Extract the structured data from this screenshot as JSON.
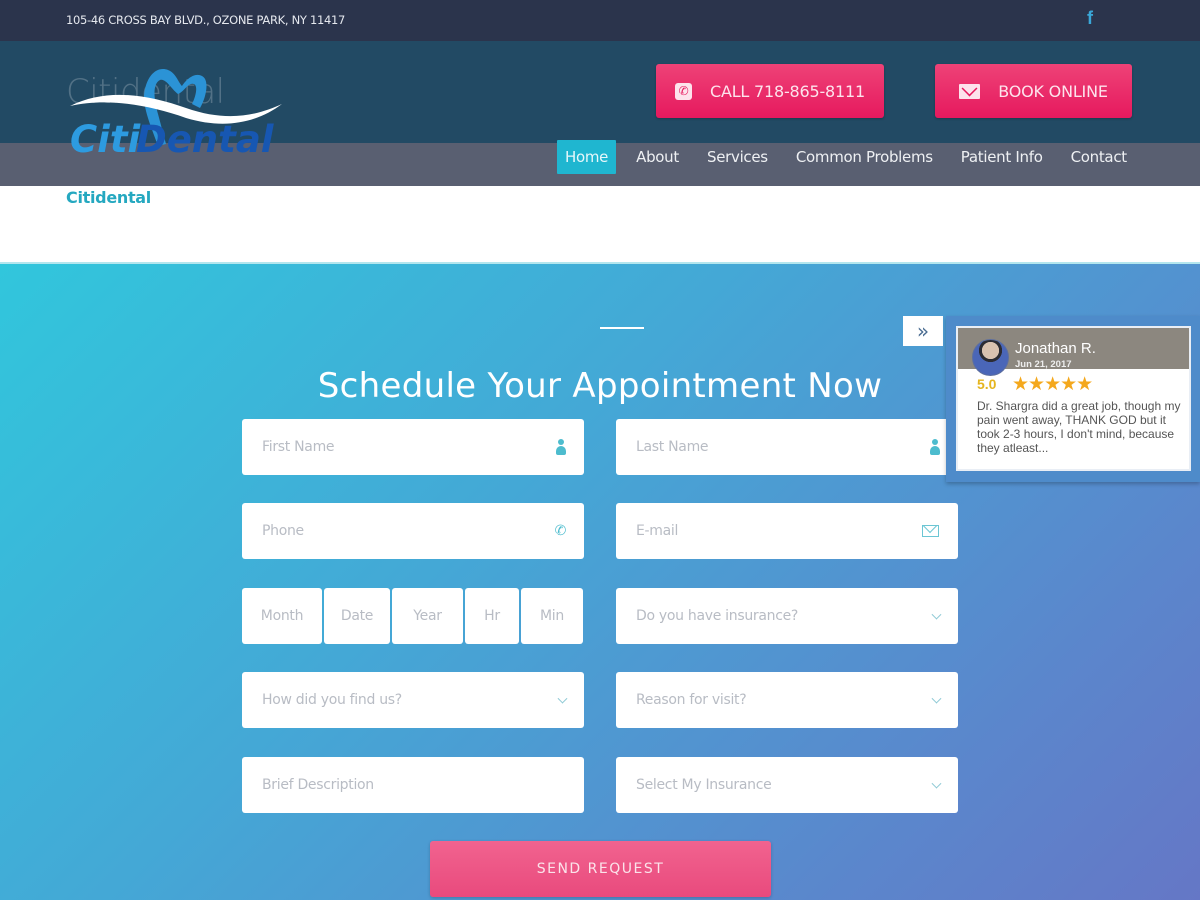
{
  "topbar": {
    "address": "105-46 CROSS BAY BLVD., OZONE PARK, NY 11417",
    "social_icon": "facebook-icon",
    "social_glyph": "f"
  },
  "header": {
    "logo_ghost_text": "Citidental",
    "logo_text_part1": "Citi",
    "logo_text_part2": "Dental",
    "call_button": {
      "label": "CALL 718-865-8111",
      "icon": "phone-icon"
    },
    "book_button": {
      "label": "BOOK ONLINE",
      "icon": "envelope-icon"
    },
    "brand_colors": {
      "pink": "#e6195e",
      "teal": "#1fb6d0",
      "dark": "#224a64"
    }
  },
  "nav": {
    "items": [
      {
        "label": "Home",
        "active": true
      },
      {
        "label": "About",
        "active": false
      },
      {
        "label": "Services",
        "active": false
      },
      {
        "label": "Common Problems",
        "active": false
      },
      {
        "label": "Patient Info",
        "active": false
      },
      {
        "label": "Contact",
        "active": false
      }
    ]
  },
  "site_title": "Citidental",
  "form": {
    "title": "Schedule Your Appointment Now",
    "first_name": {
      "placeholder": "First Name",
      "value": ""
    },
    "last_name": {
      "placeholder": "Last Name",
      "value": ""
    },
    "phone": {
      "placeholder": "Phone",
      "value": ""
    },
    "email": {
      "placeholder": "E-mail",
      "value": ""
    },
    "month": {
      "placeholder": "Month"
    },
    "date": {
      "placeholder": "Date"
    },
    "year": {
      "placeholder": "Year"
    },
    "hour": {
      "placeholder": "Hr"
    },
    "minute": {
      "placeholder": "Min"
    },
    "insurance_question": {
      "selected": "Do you have insurance?"
    },
    "find_us": {
      "selected": "How did you find us?"
    },
    "reason": {
      "selected": "Reason for visit?"
    },
    "description": {
      "placeholder": "Brief Description"
    },
    "select_insurance": {
      "selected": "Select My Insurance"
    },
    "submit_label": "SEND REQUEST"
  },
  "review_widget": {
    "toggle_glyph": "»",
    "reviewer": "Jonathan R.",
    "date": "Jun 21, 2017",
    "score": "5.0",
    "rating": 5,
    "rating_max": 5,
    "stars": "★★★★★",
    "text": "Dr. Shargra did a great job, though my pain went away, THANK GOD but it took 2-3 hours, I don't mind, because they atleast..."
  }
}
